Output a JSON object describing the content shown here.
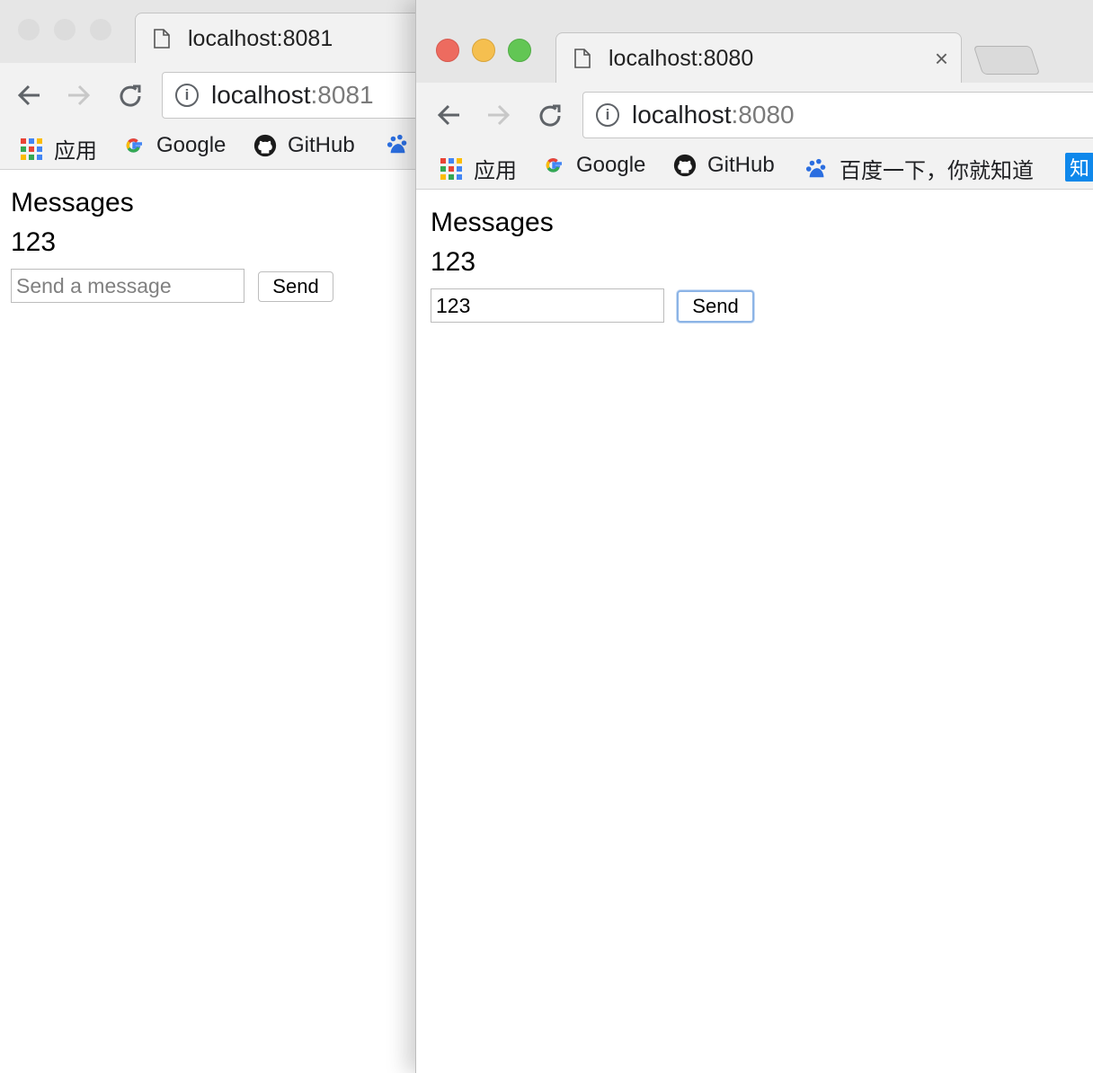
{
  "back_window": {
    "tab_title": "localhost:8081",
    "address": {
      "host": "localhost",
      "port": ":8081"
    },
    "bookmarks": {
      "apps": "应用",
      "google": "Google",
      "github": "GitHub"
    },
    "page": {
      "heading": "Messages",
      "messages": [
        "123"
      ],
      "input_placeholder": "Send a message",
      "input_value": "",
      "send_label": "Send"
    }
  },
  "front_window": {
    "tab_title": "localhost:8080",
    "tab_close": "×",
    "address": {
      "host": "localhost",
      "port": ":8080"
    },
    "bookmarks": {
      "apps": "应用",
      "google": "Google",
      "github": "GitHub",
      "baidu": "百度一下，你就知道",
      "zhihu": "知"
    },
    "page": {
      "heading": "Messages",
      "messages": [
        "123"
      ],
      "input_value": "123",
      "send_label": "Send"
    }
  },
  "colors": {
    "traffic_close": "#ed6b5f",
    "traffic_minimize": "#f5bf4f",
    "traffic_zoom": "#62c654",
    "traffic_inactive": "#dcdcdc",
    "zhihu_blue": "#0f88eb"
  },
  "icons": {
    "back": "arrow-left-icon",
    "forward": "arrow-right-icon",
    "reload": "reload-icon",
    "info": "info-icon",
    "page": "page-document-icon",
    "apps": "apps-grid-icon",
    "google": "google-logo-icon",
    "github": "github-logo-icon",
    "baidu": "baidu-paw-icon"
  }
}
